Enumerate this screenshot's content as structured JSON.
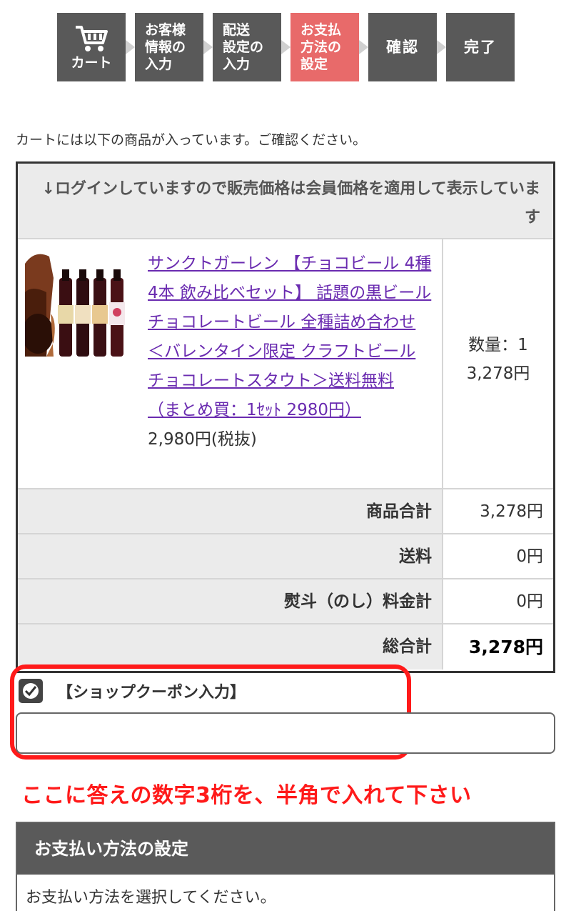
{
  "steps": [
    {
      "label": "カート",
      "icon": "cart-icon"
    },
    {
      "label": "お客様\n情報の\n入力"
    },
    {
      "label": "配送\n設定の\n入力"
    },
    {
      "label": "お支払\n方法の\n設定",
      "active": true
    },
    {
      "label": "確認"
    },
    {
      "label": "完了"
    }
  ],
  "intro": "カートには以下の商品が入っています。ご確認ください。",
  "cart": {
    "notice": "↓ログインしていますので販売価格は会員価格を適用して表示しています",
    "item": {
      "name": "サンクトガーレン 【チョコビール 4種4本 飲み比べセット】 話題の黒ビール チョコレートビール 全種詰め合わせ ＜バレンタイン限定 クラフトビール チョコレートスタウト＞送料無料 （まとめ買：1ｾｯﾄ 2980円）",
      "price": "2,980円(税抜)",
      "quantity": "数量：1",
      "subtotal": "3,278円"
    },
    "summary": [
      {
        "label": "商品合計",
        "value": "3,278円"
      },
      {
        "label": "送料",
        "value": "0円"
      },
      {
        "label": "熨斗（のし）料金計",
        "value": "0円"
      },
      {
        "label": "総合計",
        "value": "3,278円",
        "bold": true
      }
    ]
  },
  "coupon": {
    "label": "【ショップクーポン入力】",
    "checked": true,
    "value": "",
    "hint": "ここに答えの数字3桁を、半角で入れて下さい"
  },
  "payment": {
    "title": "お支払い方法の設定",
    "instruction": "お支払い方法を選択してください。"
  },
  "colors": {
    "active_step": "#e86a6a",
    "step": "#595959",
    "highlight": "#ff1a1a",
    "link": "#6a2bb0"
  }
}
